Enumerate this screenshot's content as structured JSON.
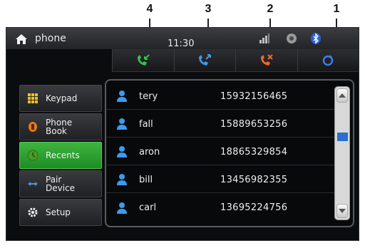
{
  "callouts": [
    "4",
    "3",
    "2",
    "1"
  ],
  "status_bar": {
    "title": "phone",
    "time": "11:30",
    "icons": [
      "home-icon",
      "signal-icon",
      "gear-icon",
      "bluetooth-icon"
    ]
  },
  "call_tabs": [
    {
      "icon": "incoming-call-icon",
      "color": "#39c24a"
    },
    {
      "icon": "outgoing-call-icon",
      "color": "#3a9bf0"
    },
    {
      "icon": "missed-call-icon",
      "color": "#f26a25"
    },
    {
      "icon": "all-calls-icon",
      "color": "#3a7ef0"
    }
  ],
  "sidebar": {
    "items": [
      {
        "label": "Keypad",
        "icon": "keypad-icon",
        "active": false
      },
      {
        "label": "Phone\nBook",
        "icon": "phonebook-icon",
        "active": false
      },
      {
        "label": "Recents",
        "icon": "recents-icon",
        "active": true
      },
      {
        "label": "Pair\nDevice",
        "icon": "pair-device-icon",
        "active": false
      },
      {
        "label": "Setup",
        "icon": "gear-icon",
        "active": false
      }
    ]
  },
  "contacts": [
    {
      "name": "tery",
      "number": "15932156465"
    },
    {
      "name": "fall",
      "number": "15889653256"
    },
    {
      "name": "aron",
      "number": "18865329854"
    },
    {
      "name": "bill",
      "number": "13456982355"
    },
    {
      "name": "carl",
      "number": "13695224756"
    }
  ],
  "colors": {
    "accent": "#2fa83a",
    "contact_icon": "#3a9bf0"
  }
}
